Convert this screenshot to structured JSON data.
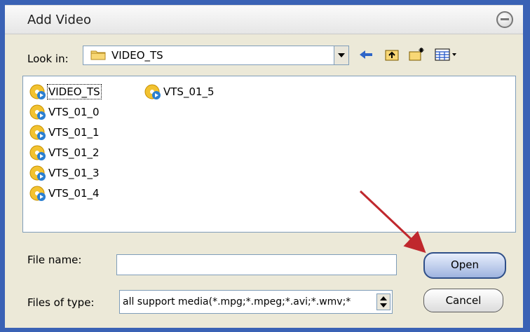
{
  "window": {
    "title": "Add Video"
  },
  "toolbar": {
    "look_in_label": "Look in:",
    "look_in_value": "VIDEO_TS"
  },
  "files": [
    {
      "name": "VIDEO_TS",
      "selected": true
    },
    {
      "name": "VTS_01_0"
    },
    {
      "name": "VTS_01_1"
    },
    {
      "name": "VTS_01_2"
    },
    {
      "name": "VTS_01_3"
    },
    {
      "name": "VTS_01_4"
    },
    {
      "name": "VTS_01_5"
    }
  ],
  "form": {
    "file_name_label": "File name:",
    "file_name_value": "",
    "file_type_label": "Files of type:",
    "file_type_value": "all support media(*.mpg;*.mpeg;*.avi;*.wmv;*"
  },
  "buttons": {
    "open": "Open",
    "cancel": "Cancel"
  },
  "colors": {
    "accent": "#3a62b5",
    "annotation_arrow": "#c0282d"
  }
}
